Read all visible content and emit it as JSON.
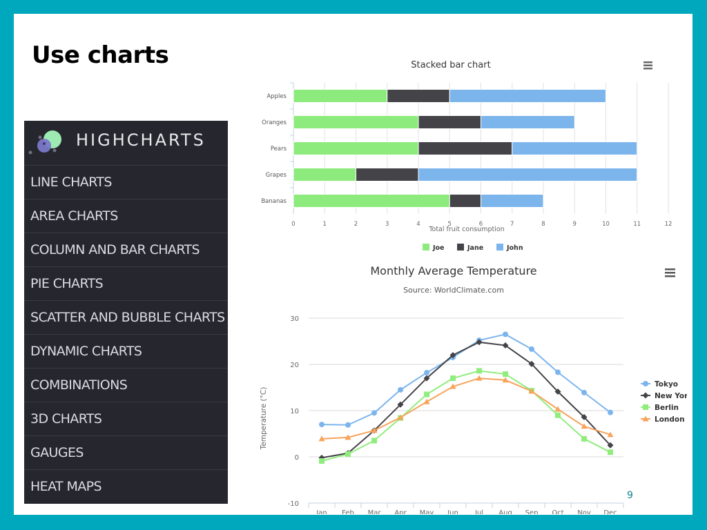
{
  "slide": {
    "title": "Use charts",
    "page_number": "9"
  },
  "colors": {
    "frame": "#00a8bd",
    "panel_bg": "#26262e",
    "joe": "#8ceb7c",
    "jane": "#434348",
    "john": "#7cb5ec",
    "tokyo": "#7cb5ec",
    "newyork": "#434348",
    "berlin": "#90ed7d",
    "london": "#f7a35c"
  },
  "highcharts": {
    "logo_text": "HIGHCHARTS",
    "menu": [
      {
        "label": "LINE CHARTS"
      },
      {
        "label": "AREA CHARTS"
      },
      {
        "label": "COLUMN AND BAR CHARTS"
      },
      {
        "label": "PIE CHARTS"
      },
      {
        "label": "SCATTER AND BUBBLE CHARTS"
      },
      {
        "label": "DYNAMIC CHARTS"
      },
      {
        "label": "COMBINATIONS"
      },
      {
        "label": "3D CHARTS"
      },
      {
        "label": "GAUGES"
      },
      {
        "label": "HEAT MAPS"
      }
    ]
  },
  "chart_data": [
    {
      "type": "bar",
      "stacked": true,
      "title": "Stacked bar chart",
      "xlabel": "Total fruit consumption",
      "ylabel": "",
      "categories": [
        "Apples",
        "Oranges",
        "Pears",
        "Grapes",
        "Bananas"
      ],
      "series": [
        {
          "name": "Joe",
          "values": [
            3,
            4,
            4,
            2,
            5
          ]
        },
        {
          "name": "Jane",
          "values": [
            2,
            2,
            3,
            2,
            1
          ]
        },
        {
          "name": "John",
          "values": [
            5,
            3,
            4,
            7,
            2
          ]
        }
      ],
      "xlim": [
        0,
        12
      ],
      "ticks": [
        "0",
        "1",
        "2",
        "3",
        "4",
        "5",
        "6",
        "7",
        "8",
        "9",
        "10",
        "11",
        "12"
      ],
      "grid": true,
      "legend": "bottom-center",
      "menu_icon": "hamburger-menu-icon"
    },
    {
      "type": "line",
      "title": "Monthly Average Temperature",
      "subtitle": "Source: WorldClimate.com",
      "xlabel": "",
      "ylabel": "Temperature (°C)",
      "categories": [
        "Jan",
        "Feb",
        "Mar",
        "Apr",
        "May",
        "Jun",
        "Jul",
        "Aug",
        "Sep",
        "Oct",
        "Nov",
        "Dec"
      ],
      "series": [
        {
          "name": "Tokyo",
          "marker": "circle",
          "values": [
            7.0,
            6.9,
            9.5,
            14.5,
            18.2,
            21.5,
            25.2,
            26.5,
            23.3,
            18.3,
            13.9,
            9.6
          ]
        },
        {
          "name": "New York",
          "marker": "diamond",
          "values": [
            -0.2,
            0.8,
            5.7,
            11.3,
            17.0,
            22.0,
            24.8,
            24.1,
            20.1,
            14.1,
            8.6,
            2.5
          ]
        },
        {
          "name": "Berlin",
          "marker": "square",
          "values": [
            -0.9,
            0.6,
            3.5,
            8.4,
            13.5,
            17.0,
            18.6,
            17.9,
            14.3,
            9.0,
            3.9,
            1.0
          ]
        },
        {
          "name": "London",
          "marker": "triangle",
          "values": [
            3.9,
            4.2,
            5.7,
            8.5,
            11.9,
            15.2,
            17.0,
            16.6,
            14.2,
            10.3,
            6.6,
            4.8
          ]
        }
      ],
      "ylim": [
        -10,
        30
      ],
      "yticks": [
        "-10",
        "0",
        "10",
        "20",
        "30"
      ],
      "grid": true,
      "legend": "right-middle",
      "menu_icon": "hamburger-menu-icon"
    }
  ]
}
